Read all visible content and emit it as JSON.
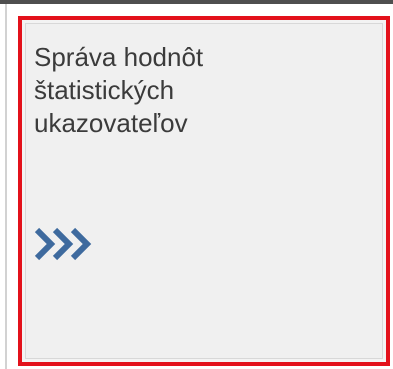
{
  "tile": {
    "title_lines": [
      "Správa hodnôt",
      "štatistických",
      "ukazovateľov"
    ],
    "icon": "triple-chevron-right-icon",
    "icon_color": "#3e6a9e",
    "highlight_color": "#e3111b"
  }
}
